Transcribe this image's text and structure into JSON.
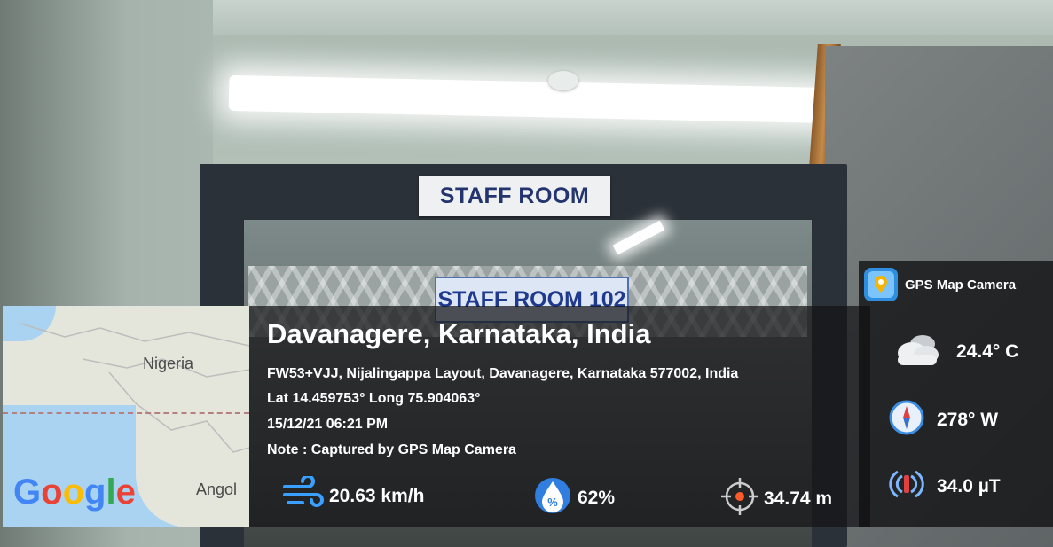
{
  "photo": {
    "sign_top": "STAFF ROOM",
    "sign_inner": "STAFF ROOM 102"
  },
  "map": {
    "labels": [
      "Nigeria",
      "Angol"
    ],
    "logo": [
      "G",
      "o",
      "o",
      "g",
      "l",
      "e"
    ]
  },
  "app": {
    "name": "GPS Map Camera",
    "icon": "map-pin-icon"
  },
  "location": {
    "place": "Davanagere, Karnataka, India",
    "address": "FW53+VJJ, Nijalingappa Layout, Davanagere, Karnataka 577002, India",
    "coords": "Lat 14.459753° Long 75.904063°",
    "datetime": "15/12/21 06:21 PM",
    "note": "Note : Captured by GPS Map Camera"
  },
  "metrics": {
    "wind": {
      "icon": "wind-icon",
      "value": "20.63 km/h"
    },
    "humidity": {
      "icon": "humidity-icon",
      "value": "62%"
    },
    "altitude": {
      "icon": "crosshair-icon",
      "value": "34.74 m"
    }
  },
  "side": {
    "temperature": {
      "icon": "cloud-icon",
      "value": "24.4° C"
    },
    "compass": {
      "icon": "compass-icon",
      "value": "278° W"
    },
    "magnetic": {
      "icon": "magnet-icon",
      "value": "34.0 µT"
    }
  },
  "colors": {
    "overlay": "#141416",
    "accent_blue": "#2f8ee0"
  }
}
